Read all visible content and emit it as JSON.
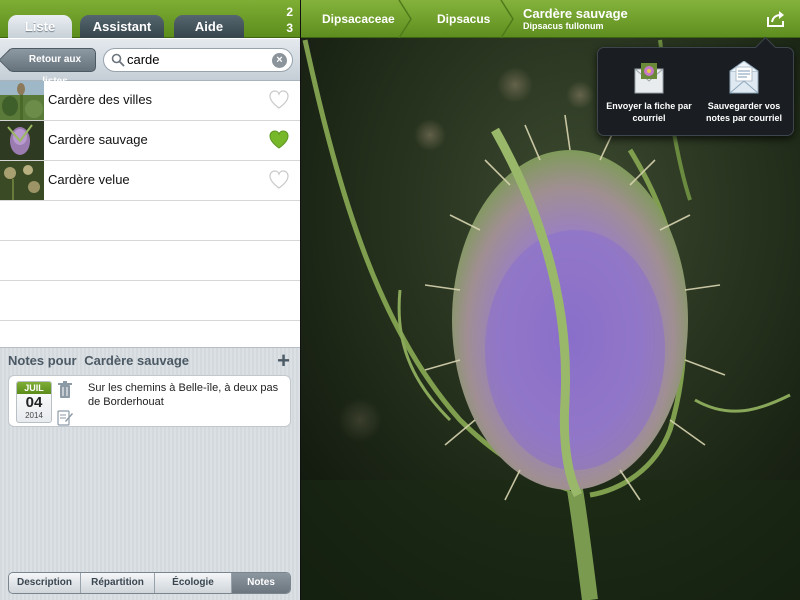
{
  "tabs": [
    {
      "label": "Liste",
      "selected": true
    },
    {
      "label": "Assistant",
      "selected": false
    },
    {
      "label": "Aide",
      "selected": false
    }
  ],
  "counter": {
    "top": "2",
    "bottom": "3"
  },
  "search": {
    "back_label": "Retour aux listes",
    "value": "carde"
  },
  "results": [
    {
      "name": "Cardère des villes",
      "favorite": false
    },
    {
      "name": "Cardère sauvage",
      "favorite": true
    },
    {
      "name": "Cardère velue",
      "favorite": false
    }
  ],
  "notes": {
    "title_prefix": "Notes pour",
    "species": "Cardère sauvage",
    "items": [
      {
        "month": "JUIL",
        "day": "04",
        "year": "2014",
        "text": "Sur les chemins à Belle-île, à deux pas de Borderhouat"
      }
    ]
  },
  "bottom_tabs": [
    {
      "label": "Description",
      "selected": false
    },
    {
      "label": "Répartition",
      "selected": false
    },
    {
      "label": "Écologie",
      "selected": false
    },
    {
      "label": "Notes",
      "selected": true
    }
  ],
  "breadcrumb": {
    "family": "Dipsacaceae",
    "genus": "Dipsacus",
    "current_title": "Cardère sauvage",
    "current_latin": "Dipsacus fullonum"
  },
  "share_menu": {
    "email_sheet": "Envoyer la fiche par courriel",
    "save_notes": "Sauvegarder vos notes par courriel"
  },
  "colors": {
    "accent": "#6fa02a",
    "heart_active": "#77b82b"
  }
}
